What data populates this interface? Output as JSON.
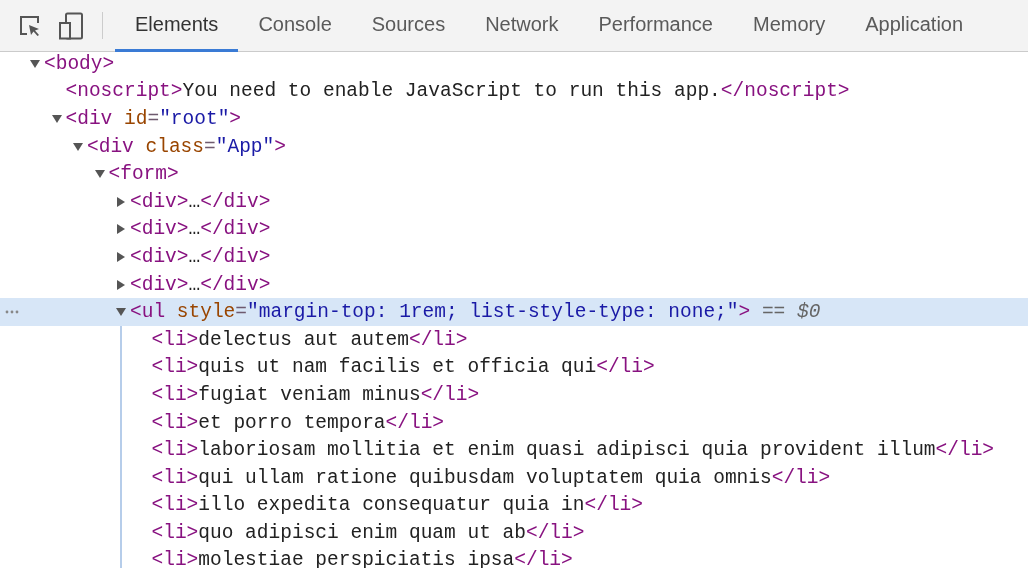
{
  "toolbar": {
    "tabs": [
      {
        "label": "Elements",
        "selected": true
      },
      {
        "label": "Console",
        "selected": false
      },
      {
        "label": "Sources",
        "selected": false
      },
      {
        "label": "Network",
        "selected": false
      },
      {
        "label": "Performance",
        "selected": false
      },
      {
        "label": "Memory",
        "selected": false
      },
      {
        "label": "Application",
        "selected": false
      }
    ]
  },
  "dom": [
    {
      "kind": "parent",
      "expanded": true,
      "selected": false,
      "tokens": [
        {
          "kind": "tag",
          "text": "<body>"
        }
      ],
      "children": [
        {
          "kind": "leaf",
          "selected": false,
          "tokens": [
            {
              "kind": "tag",
              "text": "<noscript>"
            },
            {
              "kind": "text",
              "text": "You need to enable JavaScript to run this app."
            },
            {
              "kind": "tag",
              "text": "</noscript>"
            }
          ]
        },
        {
          "kind": "parent",
          "expanded": true,
          "selected": false,
          "tokens": [
            {
              "kind": "tag",
              "text": "<div"
            },
            {
              "kind": "attr",
              "text": " id"
            },
            {
              "kind": "punct",
              "text": "="
            },
            {
              "kind": "value",
              "text": "\"root\""
            },
            {
              "kind": "tag",
              "text": ">"
            }
          ],
          "children": [
            {
              "kind": "parent",
              "expanded": true,
              "selected": false,
              "tokens": [
                {
                  "kind": "tag",
                  "text": "<div"
                },
                {
                  "kind": "attr",
                  "text": " class"
                },
                {
                  "kind": "punct",
                  "text": "="
                },
                {
                  "kind": "value",
                  "text": "\"App\""
                },
                {
                  "kind": "tag",
                  "text": ">"
                }
              ],
              "children": [
                {
                  "kind": "parent",
                  "expanded": true,
                  "selected": false,
                  "tokens": [
                    {
                      "kind": "tag",
                      "text": "<form>"
                    }
                  ],
                  "children": [
                    {
                      "kind": "parent",
                      "expanded": false,
                      "selected": false,
                      "tokens": [
                        {
                          "kind": "tag",
                          "text": "<div>"
                        },
                        {
                          "kind": "text",
                          "text": "…"
                        },
                        {
                          "kind": "tag",
                          "text": "</div>"
                        }
                      ]
                    },
                    {
                      "kind": "parent",
                      "expanded": false,
                      "selected": false,
                      "tokens": [
                        {
                          "kind": "tag",
                          "text": "<div>"
                        },
                        {
                          "kind": "text",
                          "text": "…"
                        },
                        {
                          "kind": "tag",
                          "text": "</div>"
                        }
                      ]
                    },
                    {
                      "kind": "parent",
                      "expanded": false,
                      "selected": false,
                      "tokens": [
                        {
                          "kind": "tag",
                          "text": "<div>"
                        },
                        {
                          "kind": "text",
                          "text": "…"
                        },
                        {
                          "kind": "tag",
                          "text": "</div>"
                        }
                      ]
                    },
                    {
                      "kind": "parent",
                      "expanded": false,
                      "selected": false,
                      "tokens": [
                        {
                          "kind": "tag",
                          "text": "<div>"
                        },
                        {
                          "kind": "text",
                          "text": "…"
                        },
                        {
                          "kind": "tag",
                          "text": "</div>"
                        }
                      ]
                    },
                    {
                      "kind": "parent",
                      "expanded": true,
                      "selected": true,
                      "tokens": [
                        {
                          "kind": "tag",
                          "text": "<ul"
                        },
                        {
                          "kind": "attr",
                          "text": " style"
                        },
                        {
                          "kind": "punct",
                          "text": "="
                        },
                        {
                          "kind": "value",
                          "text": "\"margin-top: 1rem; list-style-type: none;\""
                        },
                        {
                          "kind": "tag",
                          "text": ">"
                        },
                        {
                          "kind": "marker",
                          "text": " == "
                        },
                        {
                          "kind": "var",
                          "text": "$0"
                        }
                      ],
                      "children": [
                        {
                          "kind": "leaf",
                          "selected": false,
                          "tokens": [
                            {
                              "kind": "tag",
                              "text": "<li>"
                            },
                            {
                              "kind": "text",
                              "text": "delectus aut autem"
                            },
                            {
                              "kind": "tag",
                              "text": "</li>"
                            }
                          ]
                        },
                        {
                          "kind": "leaf",
                          "selected": false,
                          "tokens": [
                            {
                              "kind": "tag",
                              "text": "<li>"
                            },
                            {
                              "kind": "text",
                              "text": "quis ut nam facilis et officia qui"
                            },
                            {
                              "kind": "tag",
                              "text": "</li>"
                            }
                          ]
                        },
                        {
                          "kind": "leaf",
                          "selected": false,
                          "tokens": [
                            {
                              "kind": "tag",
                              "text": "<li>"
                            },
                            {
                              "kind": "text",
                              "text": "fugiat veniam minus"
                            },
                            {
                              "kind": "tag",
                              "text": "</li>"
                            }
                          ]
                        },
                        {
                          "kind": "leaf",
                          "selected": false,
                          "tokens": [
                            {
                              "kind": "tag",
                              "text": "<li>"
                            },
                            {
                              "kind": "text",
                              "text": "et porro tempora"
                            },
                            {
                              "kind": "tag",
                              "text": "</li>"
                            }
                          ]
                        },
                        {
                          "kind": "leaf",
                          "selected": false,
                          "tokens": [
                            {
                              "kind": "tag",
                              "text": "<li>"
                            },
                            {
                              "kind": "text",
                              "text": "laboriosam mollitia et enim quasi adipisci quia provident illum"
                            },
                            {
                              "kind": "tag",
                              "text": "</li>"
                            }
                          ]
                        },
                        {
                          "kind": "leaf",
                          "selected": false,
                          "tokens": [
                            {
                              "kind": "tag",
                              "text": "<li>"
                            },
                            {
                              "kind": "text",
                              "text": "qui ullam ratione quibusdam voluptatem quia omnis"
                            },
                            {
                              "kind": "tag",
                              "text": "</li>"
                            }
                          ]
                        },
                        {
                          "kind": "leaf",
                          "selected": false,
                          "tokens": [
                            {
                              "kind": "tag",
                              "text": "<li>"
                            },
                            {
                              "kind": "text",
                              "text": "illo expedita consequatur quia in"
                            },
                            {
                              "kind": "tag",
                              "text": "</li>"
                            }
                          ]
                        },
                        {
                          "kind": "leaf",
                          "selected": false,
                          "tokens": [
                            {
                              "kind": "tag",
                              "text": "<li>"
                            },
                            {
                              "kind": "text",
                              "text": "quo adipisci enim quam ut ab"
                            },
                            {
                              "kind": "tag",
                              "text": "</li>"
                            }
                          ]
                        },
                        {
                          "kind": "leaf",
                          "selected": false,
                          "tokens": [
                            {
                              "kind": "tag",
                              "text": "<li>"
                            },
                            {
                              "kind": "text",
                              "text": "molestiae perspiciatis ipsa"
                            },
                            {
                              "kind": "tag",
                              "text": "</li>"
                            }
                          ]
                        }
                      ]
                    }
                  ]
                }
              ]
            }
          ]
        }
      ]
    }
  ]
}
